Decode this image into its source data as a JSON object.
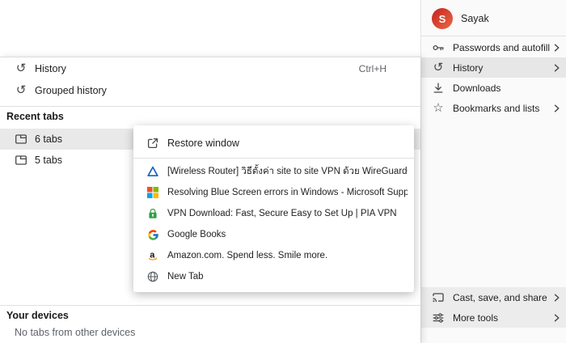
{
  "chrome_menu": {
    "profile": {
      "name": "Sayak",
      "avatar_letter": "S"
    },
    "items": [
      {
        "label": "Passwords and autofill",
        "icon": "key-icon",
        "has_submenu": true
      },
      {
        "label": "History",
        "icon": "history-icon",
        "has_submenu": true,
        "highlighted": true
      },
      {
        "label": "Downloads",
        "icon": "download-icon",
        "has_submenu": false
      },
      {
        "label": "Bookmarks and lists",
        "icon": "star-icon",
        "has_submenu": true
      },
      {
        "label": "Cast, save, and share",
        "icon": "cast-icon",
        "has_submenu": true
      },
      {
        "label": "More tools",
        "icon": "tools-icon",
        "has_submenu": true
      }
    ]
  },
  "history_menu": {
    "items": [
      {
        "label": "History",
        "shortcut": "Ctrl+H",
        "icon": "history-icon"
      },
      {
        "label": "Grouped history",
        "icon": "history-icon"
      }
    ],
    "recent_tabs": {
      "header": "Recent tabs",
      "items": [
        {
          "label": "6 tabs",
          "icon": "tab-icon",
          "highlighted": true
        },
        {
          "label": "5 tabs",
          "icon": "tab-icon",
          "highlighted": false
        }
      ]
    },
    "your_devices": {
      "header": "Your devices",
      "empty_text": "No tabs from other devices"
    }
  },
  "tabs_submenu": {
    "restore_window_label": "Restore window",
    "tabs": [
      {
        "title": "[Wireless Router] วิธีตั้งค่า site to site VPN ด้วย WireGuard®? | การสนับสนุนอย่างเป็นทางการ | ASUS ประเทศไทย",
        "favicon": "asus-logo"
      },
      {
        "title": "Resolving Blue Screen errors in Windows - Microsoft Support",
        "favicon": "microsoft-logo"
      },
      {
        "title": "VPN Download: Fast, Secure  Easy to Set Up | PIA VPN",
        "favicon": "pia-vpn-lock"
      },
      {
        "title": "Google Books",
        "favicon": "google-logo"
      },
      {
        "title": "Amazon.com. Spend less. Smile more.",
        "favicon": "amazon-logo"
      },
      {
        "title": "New Tab",
        "favicon": "globe-icon"
      }
    ]
  },
  "icons": {
    "history_glyph": "↺",
    "star_glyph": "☆"
  },
  "colors": {
    "highlight": "#e9e9e9",
    "text_primary": "#1f1f1f",
    "text_secondary": "#5f6368",
    "avatar_bg": "#d8492f",
    "divider": "#e0e0e0",
    "ms_red": "#f25022",
    "ms_green": "#7fba00",
    "ms_blue": "#00a4ef",
    "ms_yellow": "#ffb900",
    "pia_green": "#2e9e4f",
    "asus_blue": "#1565c0",
    "amazon_orange": "#ff9900"
  }
}
